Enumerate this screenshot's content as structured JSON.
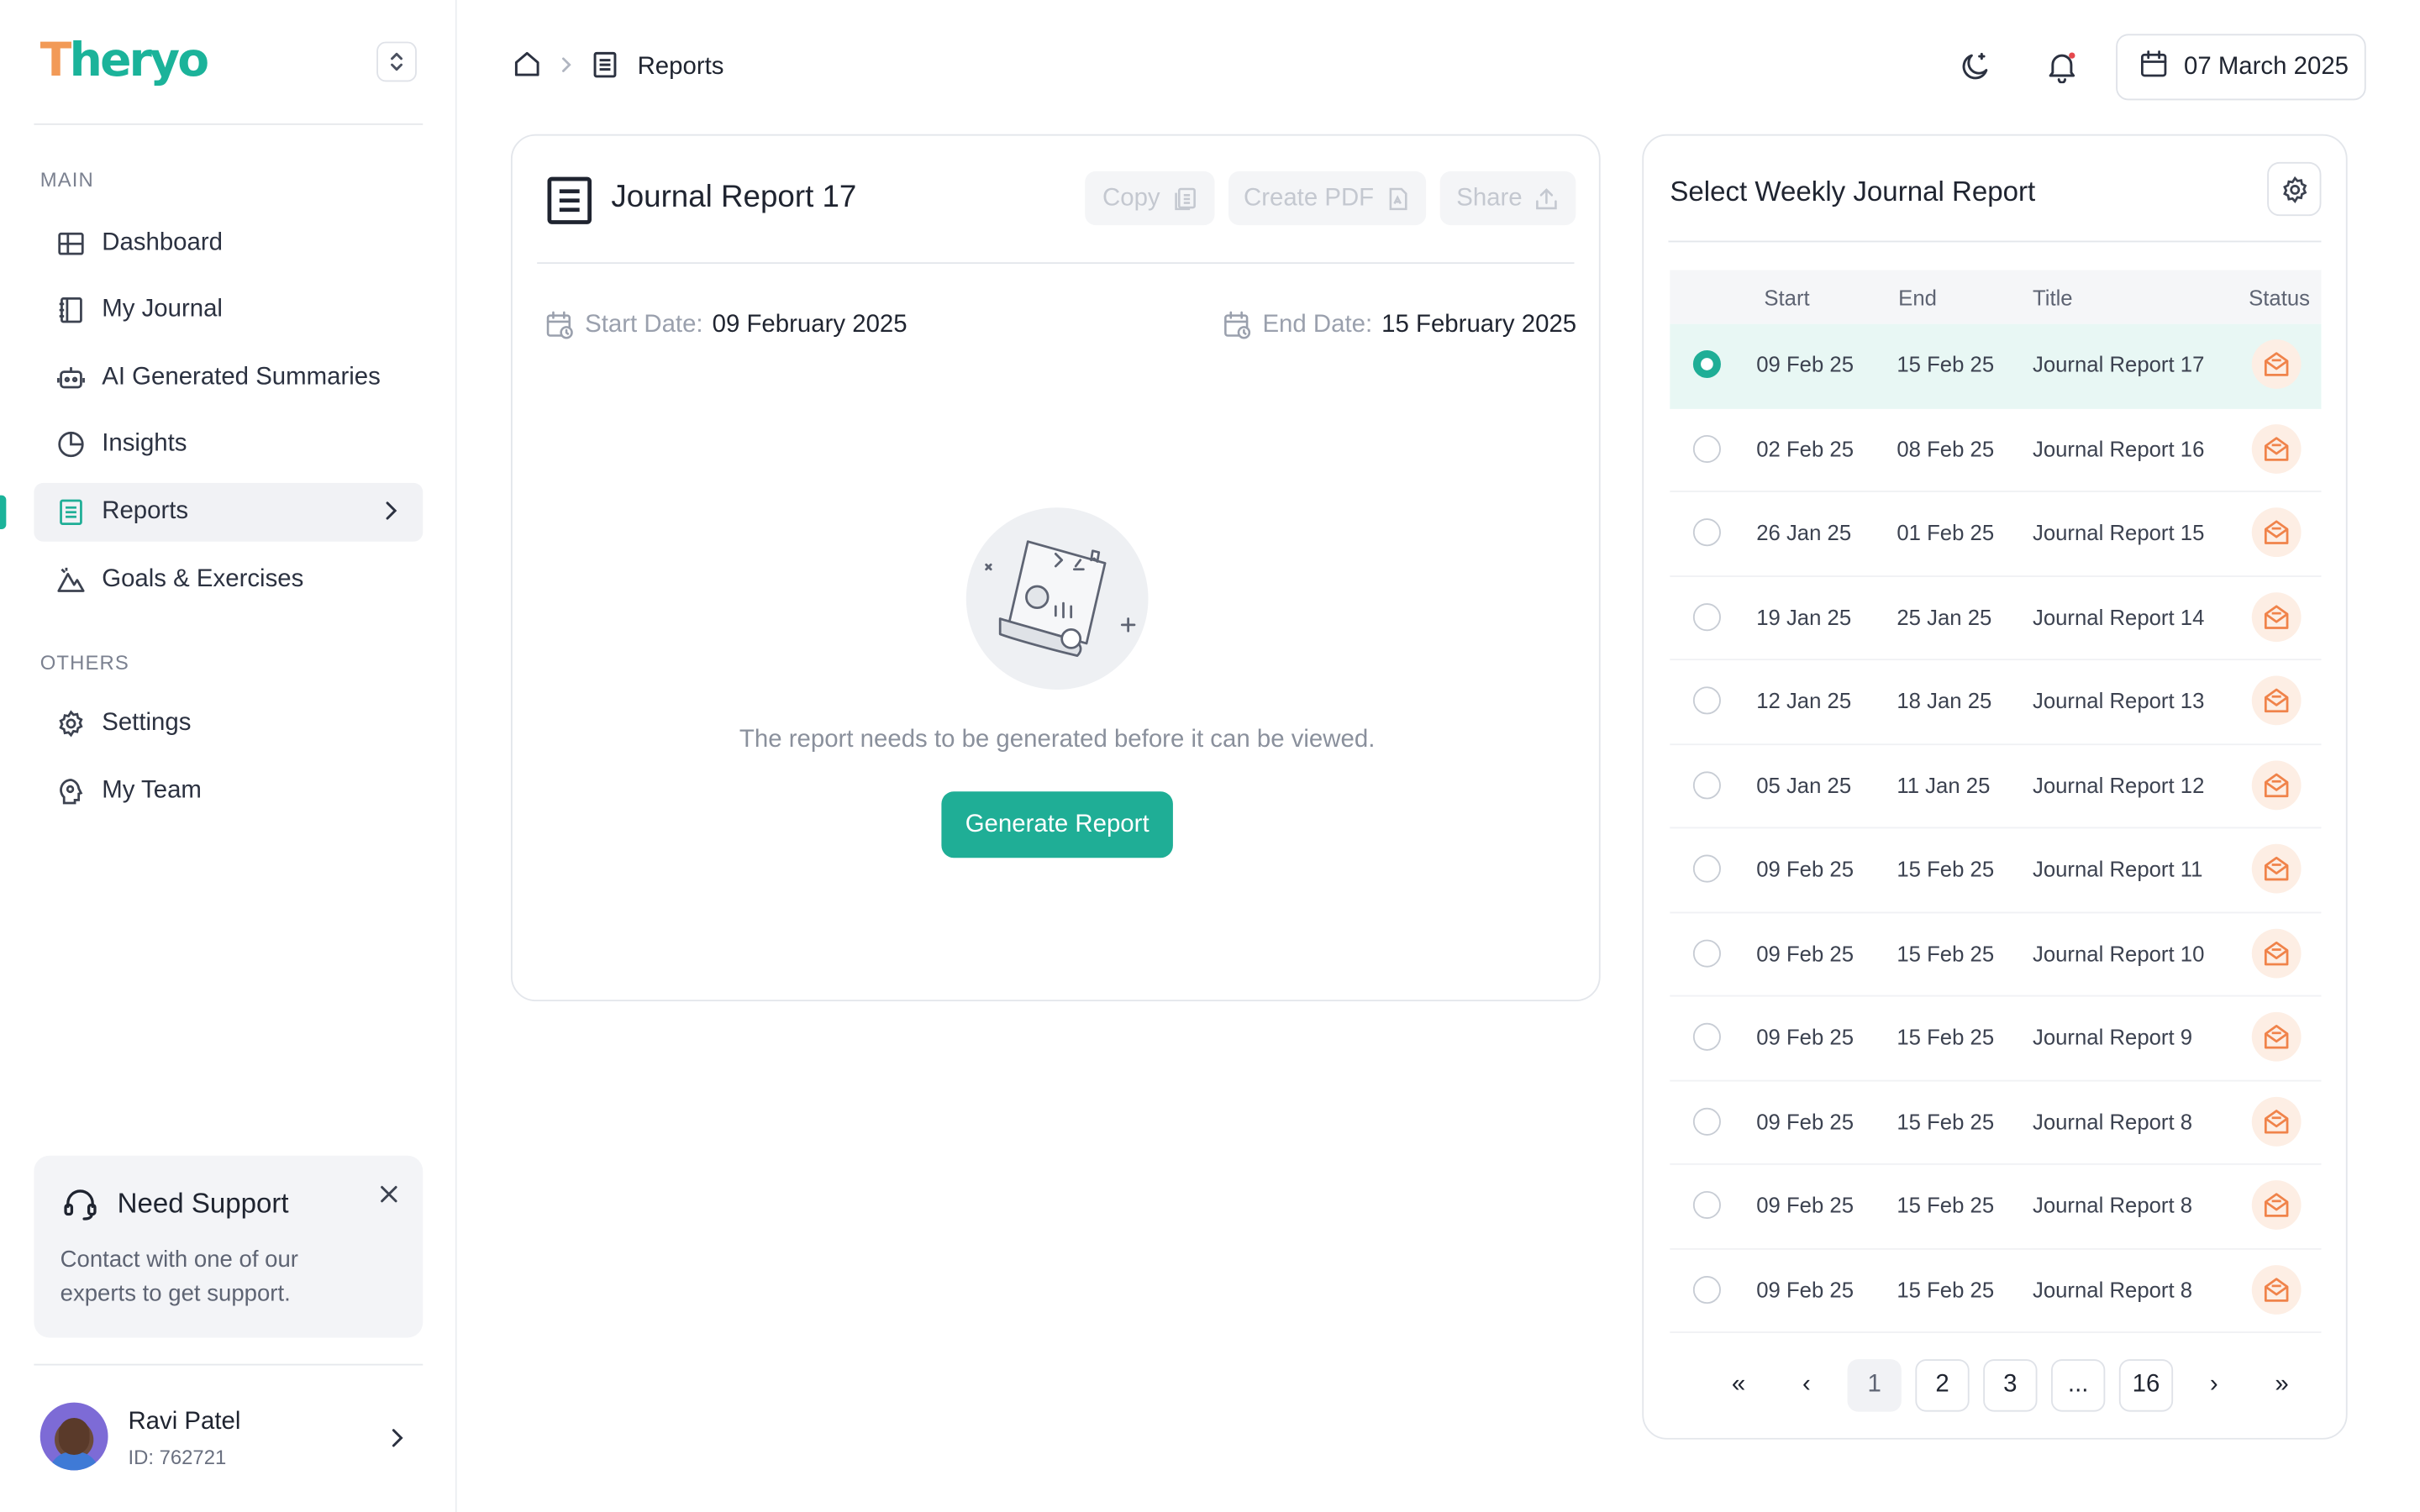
{
  "app": {
    "logo_first": "T",
    "logo_rest": "heryo"
  },
  "sidebar": {
    "main_label": "MAIN",
    "others_label": "OTHERS",
    "main_items": [
      {
        "label": "Dashboard",
        "icon": "grid-icon"
      },
      {
        "label": "My Journal",
        "icon": "notebook-icon"
      },
      {
        "label": "AI Generated Summaries",
        "icon": "robot-icon"
      },
      {
        "label": "Insights",
        "icon": "pie-chart-icon"
      },
      {
        "label": "Reports",
        "icon": "report-icon",
        "active": true
      },
      {
        "label": "Goals & Exercises",
        "icon": "mountain-icon"
      }
    ],
    "other_items": [
      {
        "label": "Settings",
        "icon": "gear-icon"
      },
      {
        "label": "My Team",
        "icon": "team-icon"
      }
    ],
    "support": {
      "title": "Need Support",
      "text": "Contact with one of our experts to get support."
    },
    "user": {
      "name": "Ravi Patel",
      "id": "ID: 762721"
    }
  },
  "header": {
    "breadcrumb": "Reports",
    "date": "07 March 2025"
  },
  "report": {
    "title": "Journal Report 17",
    "copy_label": "Copy",
    "pdf_label": "Create PDF",
    "share_label": "Share",
    "start_label": "Start Date:",
    "start_value": "09 February 2025",
    "end_label": "End Date:",
    "end_value": "15 February 2025",
    "empty_message": "The report needs to be generated before it can be viewed.",
    "generate_label": "Generate Report"
  },
  "weekly": {
    "title": "Select Weekly Journal Report",
    "columns": {
      "start": "Start",
      "end": "End",
      "title": "Title",
      "status": "Status"
    },
    "rows": [
      {
        "start": "09 Feb 25",
        "end": "15 Feb 25",
        "title": "Journal Report 17",
        "selected": true
      },
      {
        "start": "02 Feb 25",
        "end": "08 Feb 25",
        "title": "Journal Report 16",
        "selected": false
      },
      {
        "start": "26 Jan 25",
        "end": "01 Feb 25",
        "title": "Journal Report 15",
        "selected": false
      },
      {
        "start": "19 Jan 25",
        "end": "25 Jan 25",
        "title": "Journal Report 14",
        "selected": false
      },
      {
        "start": "12 Jan 25",
        "end": "18 Jan 25",
        "title": "Journal Report 13",
        "selected": false
      },
      {
        "start": "05 Jan 25",
        "end": "11 Jan 25",
        "title": "Journal Report 12",
        "selected": false
      },
      {
        "start": "09 Feb 25",
        "end": "15 Feb 25",
        "title": "Journal Report 11",
        "selected": false
      },
      {
        "start": "09 Feb 25",
        "end": "15 Feb 25",
        "title": "Journal Report 10",
        "selected": false
      },
      {
        "start": "09 Feb 25",
        "end": "15 Feb 25",
        "title": "Journal Report 9",
        "selected": false
      },
      {
        "start": "09 Feb 25",
        "end": "15 Feb 25",
        "title": "Journal Report 8",
        "selected": false
      },
      {
        "start": "09 Feb 25",
        "end": "15 Feb 25",
        "title": "Journal Report 8",
        "selected": false
      },
      {
        "start": "09 Feb 25",
        "end": "15 Feb 25",
        "title": "Journal Report 8",
        "selected": false
      }
    ],
    "pagination": {
      "first": "«",
      "prev": "‹",
      "pages": [
        "1",
        "2",
        "3",
        "...",
        "16"
      ],
      "current": "1",
      "next": "›",
      "last": "»"
    }
  },
  "colors": {
    "accent": "#1fae96",
    "logo_orange": "#f29a57",
    "status_icon": "#f0834a"
  }
}
